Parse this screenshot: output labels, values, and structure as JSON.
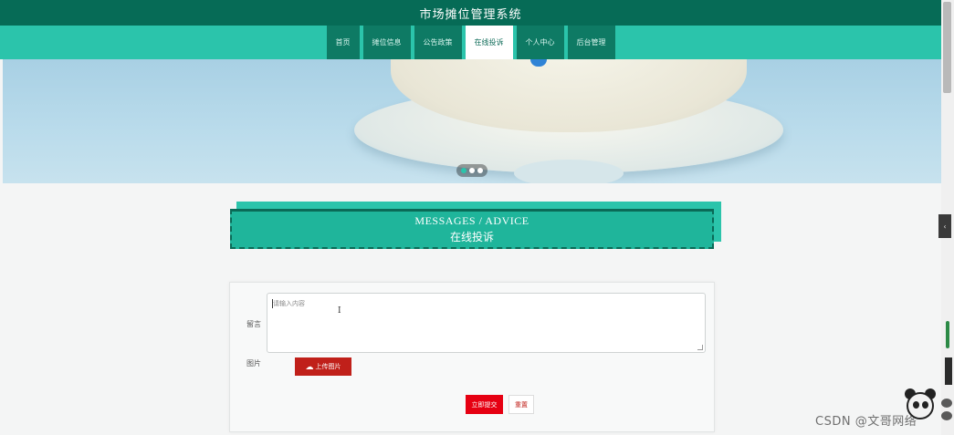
{
  "site": {
    "title": "市场摊位管理系统"
  },
  "nav": {
    "items": [
      {
        "label": "首页"
      },
      {
        "label": "摊位信息"
      },
      {
        "label": "公告政策"
      },
      {
        "label": "在线投诉"
      },
      {
        "label": "个人中心"
      },
      {
        "label": "后台管理"
      }
    ],
    "active_index": 3
  },
  "banner": {
    "slide_count": 3,
    "active_slide": 1
  },
  "section": {
    "title_en": "MESSAGES / ADVICE",
    "title_cn": "在线投诉"
  },
  "form": {
    "message_label": "留言",
    "message_placeholder": "请输入内容",
    "image_label": "图片",
    "upload_label": "上传图片",
    "submit_label": "立即提交",
    "reset_label": "重置"
  },
  "watermark": {
    "text": "CSDN @文哥网络"
  },
  "colors": {
    "header": "#066b56",
    "nav": "#2bc4ab",
    "nav_item": "#0e7a64",
    "section_head": "#1fb59b",
    "upload": "#c0201a",
    "submit": "#e60012"
  }
}
